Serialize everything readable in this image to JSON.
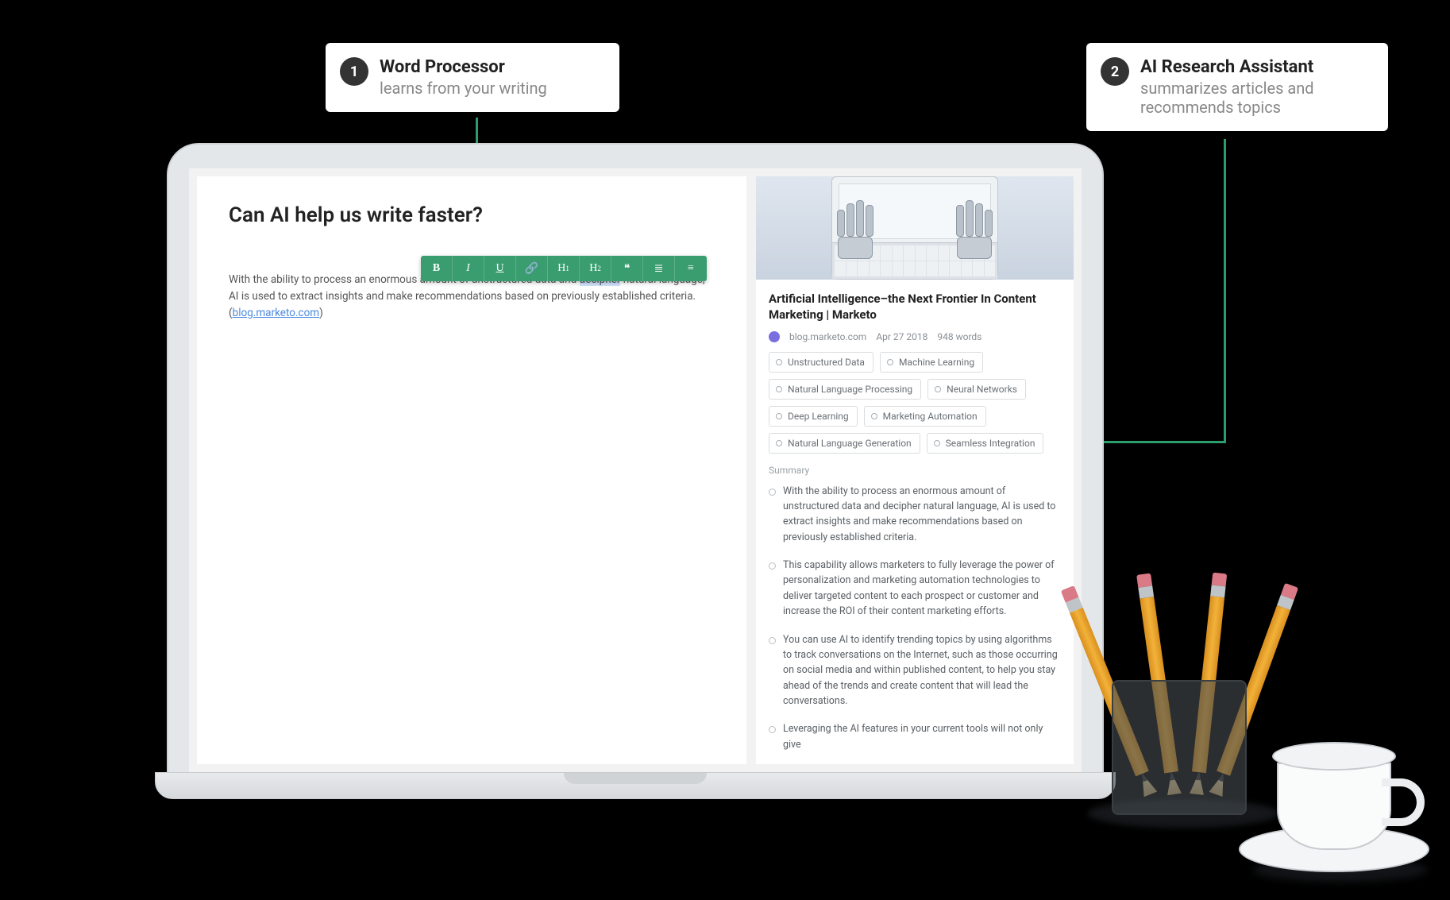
{
  "callouts": {
    "one": {
      "num": "1",
      "title": "Word Processor",
      "sub": "learns from your writing"
    },
    "two": {
      "num": "2",
      "title": "AI Research Assistant",
      "sub": "summarizes articles and recommends topics"
    }
  },
  "editor": {
    "title": "Can AI help us write faster?",
    "body_pre": "With the ability to process an enormous amount of unstructured data and ",
    "highlight": "decipher",
    "body_mid": " natural language, AI is used to extract insights and make recommendations based on previously established criteria. (",
    "link_text": "blog.marketo.com",
    "body_post": ")",
    "toolbar": {
      "bold": "B",
      "italic": "I",
      "underline": "U",
      "link": "🔗",
      "h1_letter": "H",
      "h1_sup": "1",
      "h2_letter": "H",
      "h2_sup": "2",
      "quote": "❝",
      "ul": "≣",
      "ol": "≡"
    }
  },
  "research": {
    "article_title": "Artificial Intelligence–the Next Frontier In Content Marketing | Marketo",
    "source": "blog.marketo.com",
    "date": "Apr 27 2018",
    "words": "948 words",
    "tags": [
      "Unstructured Data",
      "Machine Learning",
      "Natural Language Processing",
      "Neural Networks",
      "Deep Learning",
      "Marketing Automation",
      "Natural Language Generation",
      "Seamless Integration"
    ],
    "summary_label": "Summary",
    "summary": [
      "With the ability to process an enormous amount of unstructured data and decipher natural language, AI is used to extract insights and make recommendations based on previously established criteria.",
      "This capability allows marketers to fully leverage the power of personalization and marketing automation technologies to deliver targeted content to each prospect or customer and increase the ROI of their content marketing efforts.",
      "You can use AI to identify trending topics by using algorithms to track conversations on the Internet, such as those occurring on social media and within published content, to help you stay ahead of the trends and create content that will lead the conversations.",
      "Leveraging the AI features in your current tools will not only give"
    ]
  }
}
